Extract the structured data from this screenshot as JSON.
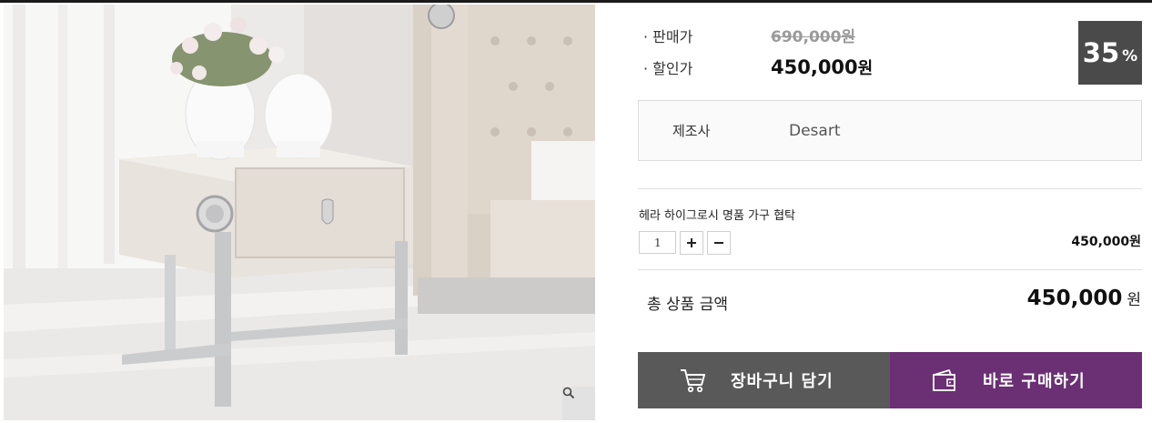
{
  "product": {
    "image_alt": "헤라 하이그로시 명품 가구 협탁",
    "zoom_icon": "magnifier-icon"
  },
  "pricing": {
    "list_label": "· 판매가",
    "list_price": "690,000원",
    "sale_label": "· 할인가",
    "sale_price": "450,000",
    "sale_unit": "원",
    "discount_number": "35",
    "discount_unit": "%"
  },
  "maker": {
    "label": "제조사",
    "value": "Desart"
  },
  "option": {
    "name": "헤라 하이그로시 명품 가구 협탁",
    "quantity": "1",
    "plus_icon": "plus-icon",
    "minus_icon": "minus-icon",
    "line_price": "450,000원"
  },
  "total": {
    "label": "총 상품 금액",
    "amount": "450,000",
    "unit": "원"
  },
  "actions": {
    "cart_label": "장바구니 담기",
    "cart_icon": "cart-icon",
    "buy_label": "바로 구매하기",
    "buy_icon": "wallet-icon"
  },
  "colors": {
    "badge_bg": "#4a4a4a",
    "cart_button": "#595959",
    "buy_button": "#6b2f74"
  }
}
